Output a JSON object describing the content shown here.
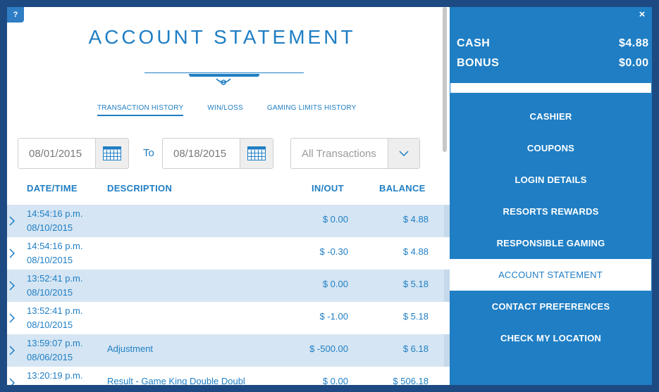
{
  "help_label": "?",
  "page_title": "ACCOUNT STATEMENT",
  "tabs": [
    {
      "label": "TRANSACTION HISTORY",
      "active": true
    },
    {
      "label": "WIN/LOSS",
      "active": false
    },
    {
      "label": "GAMING LIMITS HISTORY",
      "active": false
    }
  ],
  "filters": {
    "from_date": "08/01/2015",
    "to_label": "To",
    "to_date": "08/18/2015",
    "type_selected": "All Transactions"
  },
  "table": {
    "headers": [
      "DATE/TIME",
      "DESCRIPTION",
      "IN/OUT",
      "BALANCE"
    ],
    "rows": [
      {
        "time": "14:54:16 p.m.",
        "date": "08/10/2015",
        "description": "",
        "inout": "$ 0.00",
        "balance": "$ 4.88",
        "shaded": true
      },
      {
        "time": "14:54:16 p.m.",
        "date": "08/10/2015",
        "description": "",
        "inout": "$ -0.30",
        "balance": "$ 4.88",
        "shaded": false
      },
      {
        "time": "13:52:41 p.m.",
        "date": "08/10/2015",
        "description": "",
        "inout": "$ 0.00",
        "balance": "$ 5.18",
        "shaded": true
      },
      {
        "time": "13:52:41 p.m.",
        "date": "08/10/2015",
        "description": "",
        "inout": "$ -1.00",
        "balance": "$ 5.18",
        "shaded": false
      },
      {
        "time": "13:59:07 p.m.",
        "date": "08/06/2015",
        "description": "Adjustment",
        "inout": "$ -500.00",
        "balance": "$ 6.18",
        "shaded": true
      },
      {
        "time": "13:20:19 p.m.",
        "date": "",
        "description": "Result - Game King Double Doubl",
        "inout": "$ 0.00",
        "balance": "$ 506.18",
        "shaded": false
      }
    ]
  },
  "account": {
    "close_label": "×",
    "cash_label": "CASH",
    "cash_value": "$4.88",
    "bonus_label": "BONUS",
    "bonus_value": "$0.00"
  },
  "menu": [
    {
      "label": "CASHIER",
      "active": false
    },
    {
      "label": "COUPONS",
      "active": false
    },
    {
      "label": "LOGIN DETAILS",
      "active": false
    },
    {
      "label": "RESORTS REWARDS",
      "active": false
    },
    {
      "label": "RESPONSIBLE GAMING",
      "active": false
    },
    {
      "label": "ACCOUNT STATEMENT",
      "active": true
    },
    {
      "label": "CONTACT PREFERENCES",
      "active": false
    },
    {
      "label": "CHECK MY LOCATION",
      "active": false
    }
  ],
  "colors": {
    "accent": "#1f7ec4",
    "frame": "#1d4a82",
    "row_shade": "#d5e5f3"
  }
}
